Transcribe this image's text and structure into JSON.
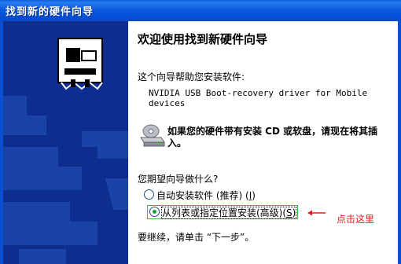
{
  "window": {
    "title": "找到新的硬件向导"
  },
  "content": {
    "heading": "欢迎使用找到新硬件向导",
    "intro": "这个向导帮助您安装软件:",
    "device_line1": "NVIDIA USB Boot-recovery driver for Mobile",
    "device_line2": "devices",
    "cd_notice": "如果您的硬件带有安装 CD 或软盘，请现在将其插入。",
    "question": "您期望向导做什么?",
    "options": [
      {
        "label": "自动安装软件 (推荐) (",
        "hotkey": "I",
        "suffix": ")",
        "selected": false
      },
      {
        "label": "从列表或指定位置安装(高级)(",
        "hotkey": "S",
        "suffix": ")",
        "selected": true
      }
    ],
    "continue_text": "要继续，请单击 “下一步”。"
  },
  "annotation": {
    "text": "点击这里",
    "color": "#e02020"
  },
  "colors": {
    "titlebar": "#0b5bdf",
    "banner": "#0d2e8e",
    "accent_green": "#3cbf3c"
  },
  "icons": {
    "banner": "hardware-wizard-icon",
    "cd": "cd-drive-icon"
  }
}
